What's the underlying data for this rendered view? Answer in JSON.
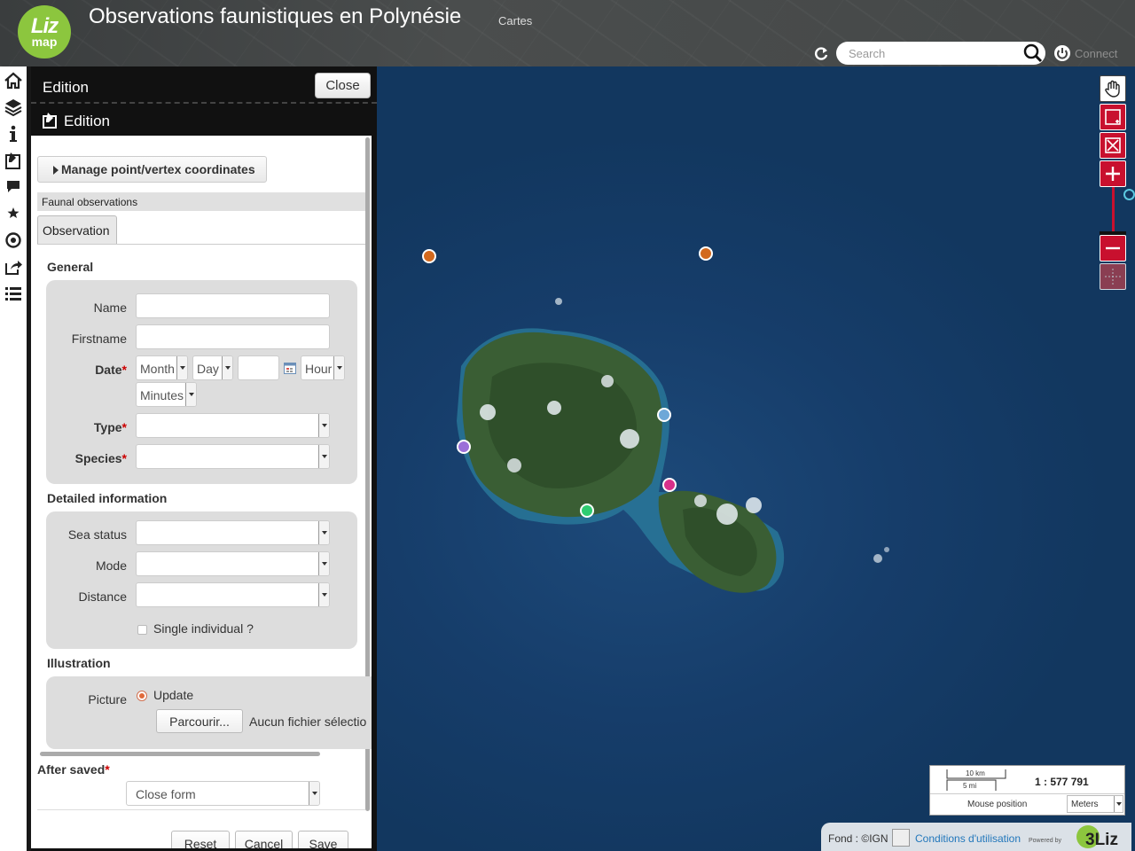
{
  "header": {
    "logo_line1": "Liz",
    "logo_line2": "map",
    "title": "Observations faunistiques en Polynésie",
    "subtitle": "Cartes",
    "search_placeholder": "Search",
    "connect_label": "Connect"
  },
  "left_bar": {
    "icons": [
      "home-icon",
      "layers-icon",
      "info-icon",
      "edition-icon",
      "comment-icon",
      "star-icon",
      "target-icon",
      "share-icon",
      "list-icon"
    ]
  },
  "panel": {
    "title": "Edition",
    "close_label": "Close",
    "subtitle": "Edition",
    "manage_label": "Manage point/vertex coordinates",
    "layer_name": "Faunal observations",
    "tab_label": "Observation",
    "general": {
      "title": "General",
      "name_label": "Name",
      "firstname_label": "Firstname",
      "date_label": "Date",
      "month_label": "Month",
      "day_label": "Day",
      "hour_label": "Hour",
      "minutes_label": "Minutes",
      "type_label": "Type",
      "species_label": "Species",
      "required_mark": "*"
    },
    "detailed": {
      "title": "Detailed information",
      "sea_status_label": "Sea status",
      "mode_label": "Mode",
      "distance_label": "Distance",
      "single_label": "Single individual ?"
    },
    "illustration": {
      "title": "Illustration",
      "picture_label": "Picture",
      "update_label": "Update",
      "browse_label": "Parcourir...",
      "no_file_label": "Aucun fichier sélectio"
    },
    "after_saved": {
      "label": "After saved",
      "required_mark": "*",
      "value": "Close form"
    },
    "buttons": {
      "reset": "Reset",
      "cancel": "Cancel",
      "save": "Save"
    }
  },
  "map": {
    "observation_points": [
      {
        "color": "#d2691e"
      },
      {
        "color": "#d2691e"
      },
      {
        "color": "#6ea8d8"
      },
      {
        "color": "#9b6fd8"
      },
      {
        "color": "#d8308a"
      },
      {
        "color": "#2ecc71"
      }
    ],
    "scale": {
      "km_label": "10 km",
      "mi_label": "5 mi",
      "ratio": "1 : 577 791",
      "mouse_position_label": "Mouse position",
      "unit": "Meters"
    },
    "attribution": {
      "fond": "Fond : ©IGN",
      "link": "Conditions d'utilisation",
      "powered": "Powered by",
      "brand": "3Liz"
    },
    "accent_color": "#c8102e"
  }
}
